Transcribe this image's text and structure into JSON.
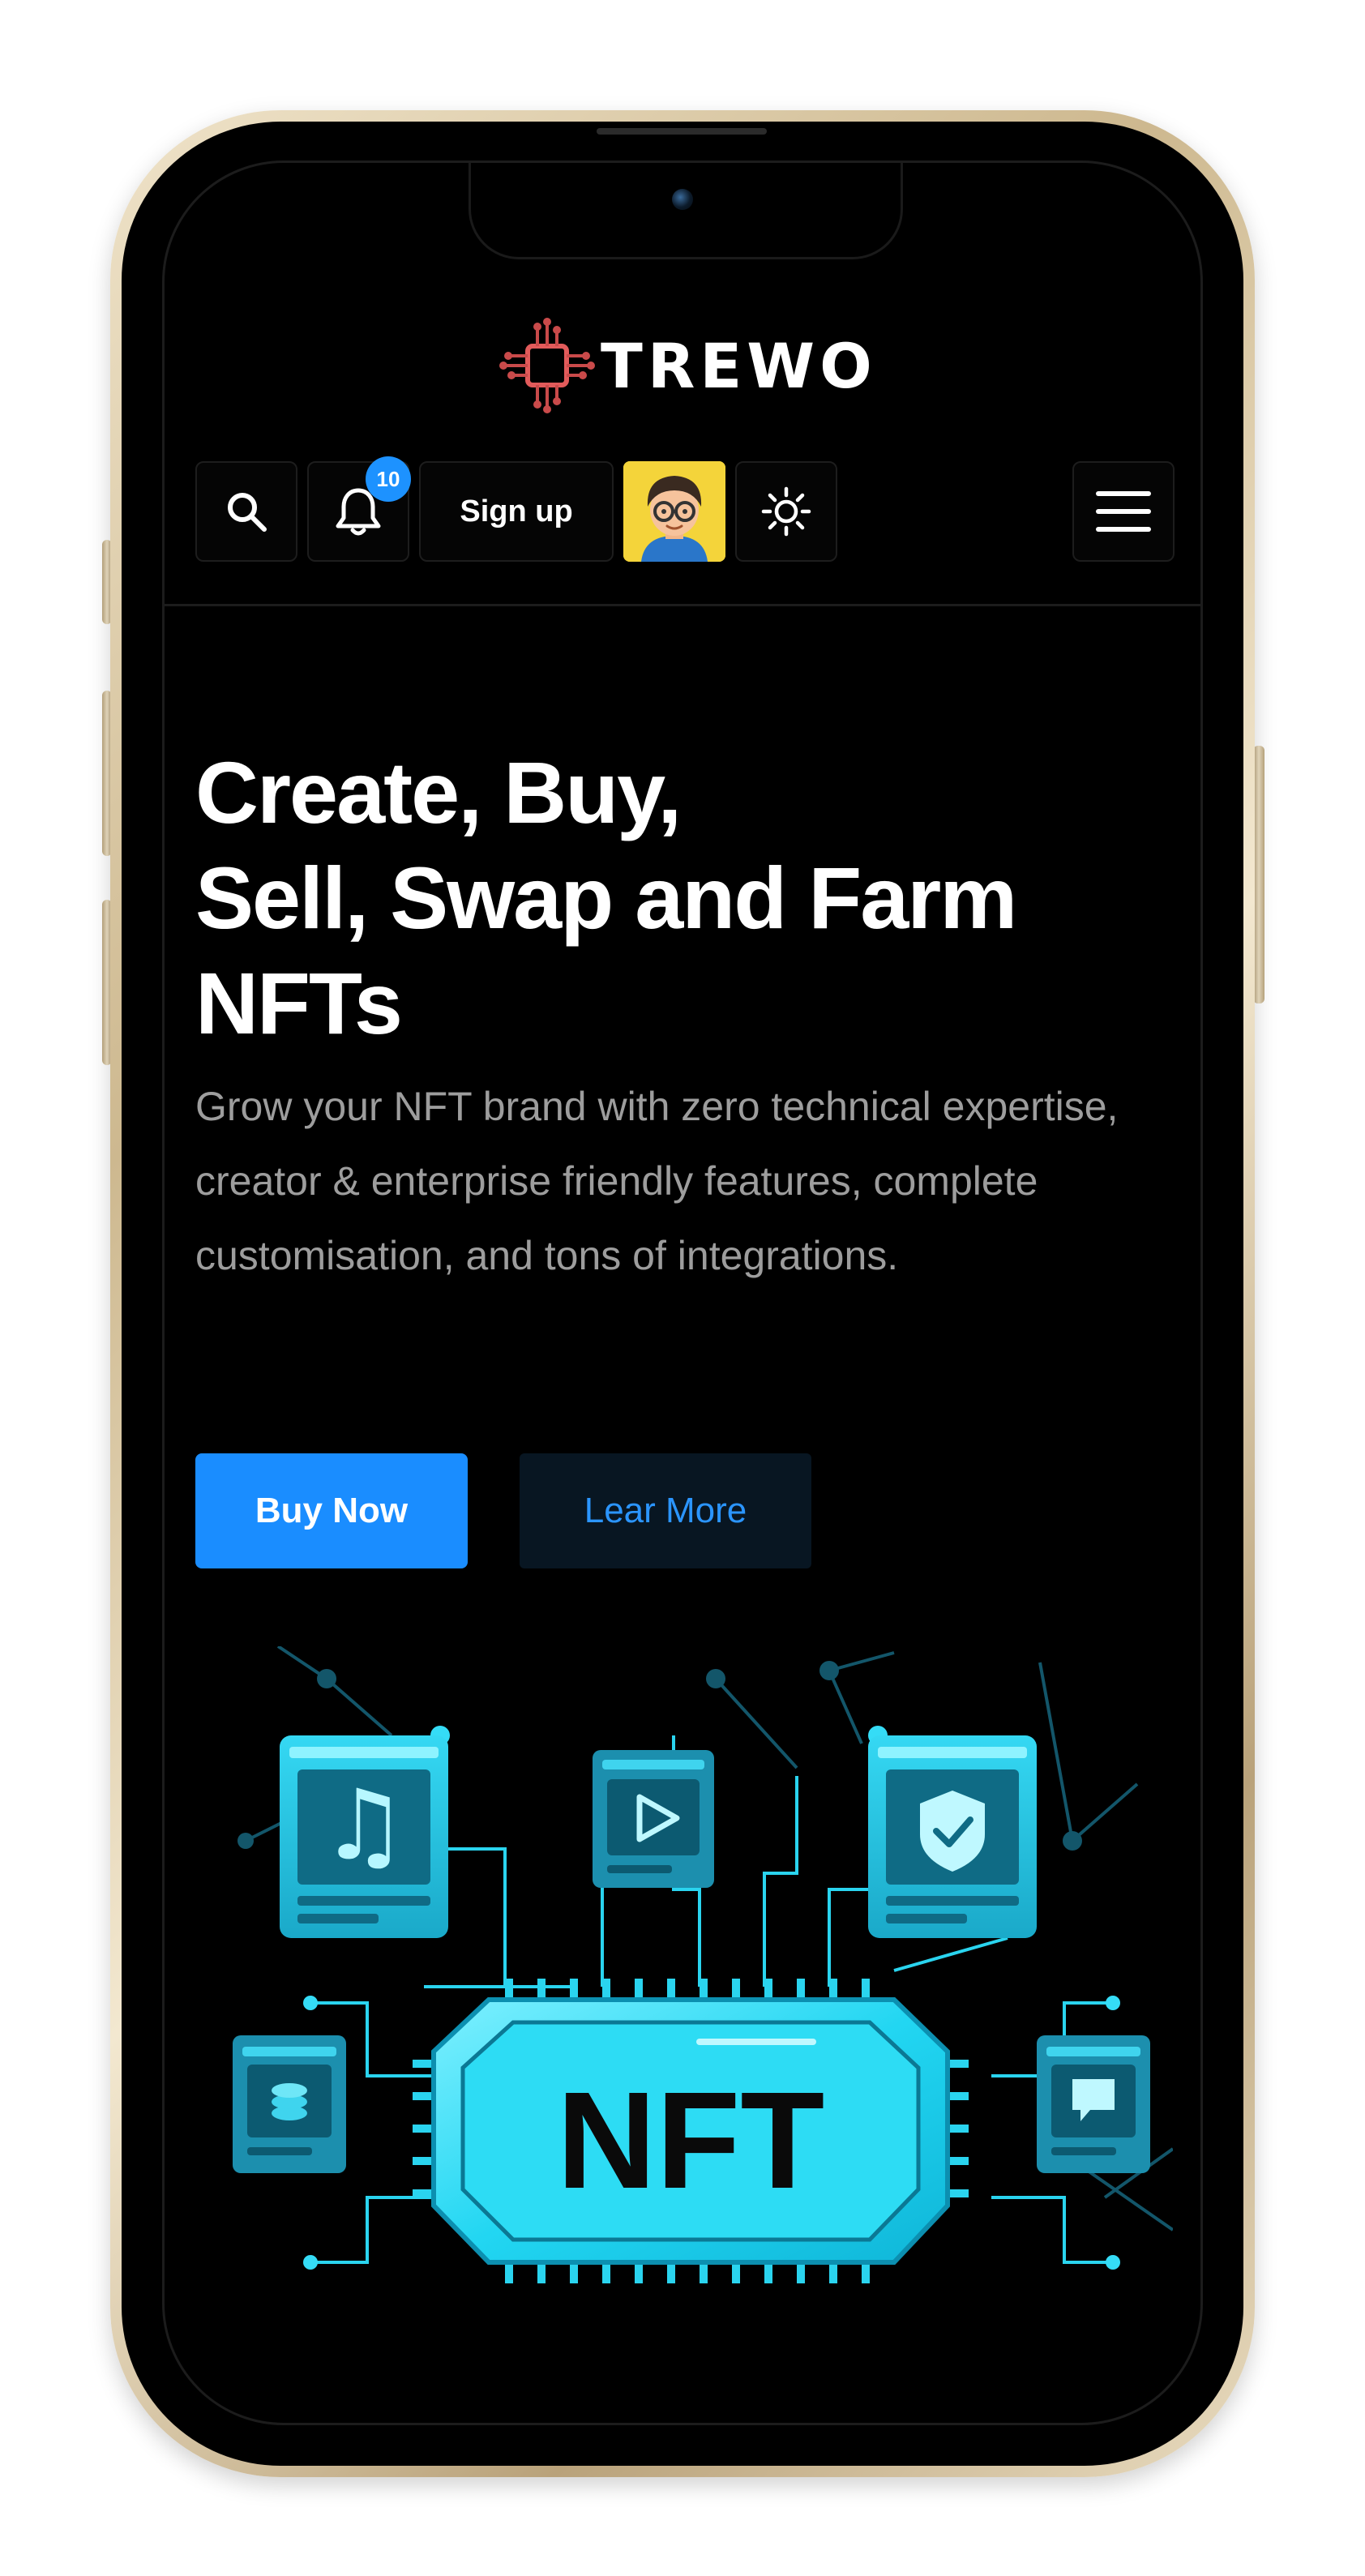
{
  "app": {
    "brand": "TREWO"
  },
  "toolbar": {
    "search_icon": "search-icon",
    "notification_count": "10",
    "signup_label": "Sign up",
    "theme_icon": "sun-icon",
    "menu_icon": "hamburger-icon"
  },
  "hero": {
    "title_lines": [
      "Create, Buy,",
      "Sell, Swap and Farm",
      "NFTs"
    ],
    "description": "Grow your NFT brand with zero technical expertise, creator & enterprise friendly features, complete customisation, and tons of integrations.",
    "buy_label": "Buy Now",
    "learn_label": "Lear More"
  },
  "illustration": {
    "chip_label": "NFT"
  },
  "colors": {
    "accent": "#1a8dff",
    "background": "#000000",
    "illustration_cyan": "#1fd0ee"
  }
}
